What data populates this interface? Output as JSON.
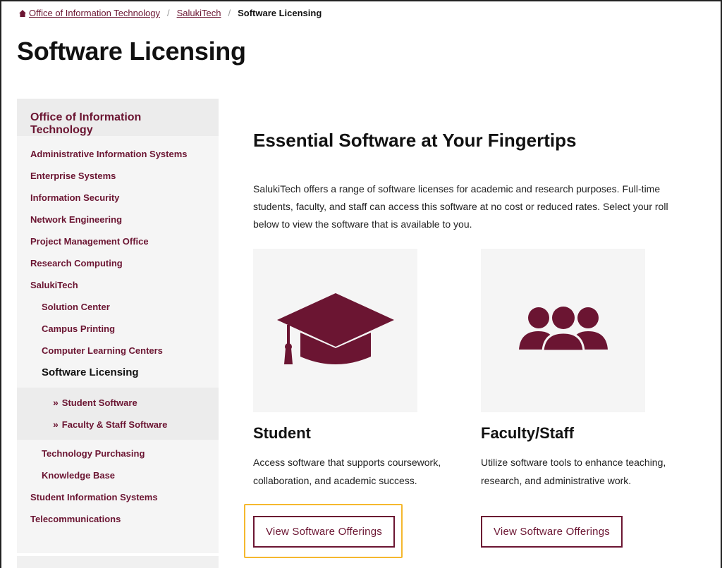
{
  "breadcrumb": {
    "home_icon": "home-icon",
    "items": [
      "Office of Information Technology",
      "SalukiTech"
    ],
    "current": "Software Licensing",
    "separator": "/"
  },
  "page_title": "Software Licensing",
  "sidebar": {
    "header": "Office of Information Technology",
    "items": [
      "Administrative Information Systems",
      "Enterprise Systems",
      "Information Security",
      "Network Engineering",
      "Project Management Office",
      "Research Computing",
      "SalukiTech"
    ],
    "salukitech_children": [
      "Solution Center",
      "Campus Printing",
      "Computer Learning Centers",
      "Software Licensing"
    ],
    "software_licensing_children": [
      "Student Software",
      "Faculty & Staff Software"
    ],
    "after_children": [
      "Technology Purchasing",
      "Knowledge Base"
    ],
    "bottom_items": [
      "Student Information Systems",
      "Telecommunications"
    ]
  },
  "main": {
    "heading": "Essential Software at Your Fingertips",
    "intro": "SalukiTech offers a range of software licenses for academic and research purposes. Full-time students, faculty, and staff can access this software at no cost or reduced rates. Select your roll below to view the software that is available to you.",
    "cards": [
      {
        "icon": "graduation-cap-icon",
        "title": "Student",
        "description": "Access software that supports coursework, collaboration, and academic success.",
        "button": "View Software Offerings"
      },
      {
        "icon": "users-group-icon",
        "title": "Faculty/Staff",
        "description": "Utilize software tools to enhance teaching, research, and administrative work.",
        "button": "View Software Offerings"
      }
    ]
  },
  "colors": {
    "brand": "#6b1532",
    "focus": "#f5b82e",
    "panel": "#f5f5f5"
  }
}
